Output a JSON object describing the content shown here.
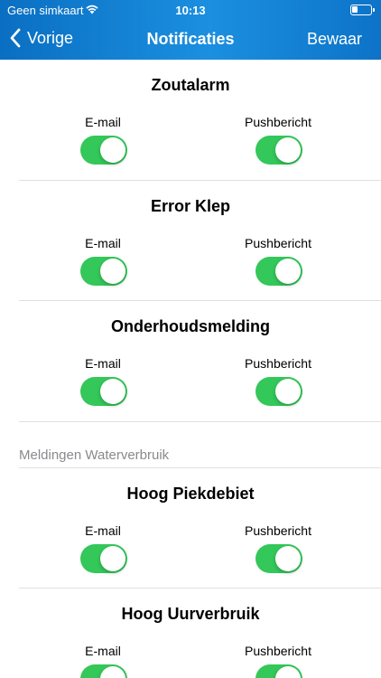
{
  "status_bar": {
    "carrier": "Geen simkaart",
    "time": "10:13",
    "battery_level": 0.3
  },
  "nav": {
    "back_label": "Vorige",
    "title": "Notificaties",
    "save_label": "Bewaar"
  },
  "colors": {
    "header_gradient_start": "#0a6fc2",
    "header_gradient_end": "#1b8fe0",
    "toggle_on": "#34c759"
  },
  "sections_top": [
    {
      "title": "Zoutalarm",
      "email_label": "E-mail",
      "push_label": "Pushbericht",
      "email_on": true,
      "push_on": true
    },
    {
      "title": "Error Klep",
      "email_label": "E-mail",
      "push_label": "Pushbericht",
      "email_on": true,
      "push_on": true
    },
    {
      "title": "Onderhoudsmelding",
      "email_label": "E-mail",
      "push_label": "Pushbericht",
      "email_on": true,
      "push_on": true
    }
  ],
  "group_header": "Meldingen Waterverbruik",
  "sections_bottom": [
    {
      "title": "Hoog Piekdebiet",
      "email_label": "E-mail",
      "push_label": "Pushbericht",
      "email_on": true,
      "push_on": true
    },
    {
      "title": "Hoog Uurverbruik",
      "email_label": "E-mail",
      "push_label": "Pushbericht",
      "email_on": true,
      "push_on": true
    }
  ]
}
